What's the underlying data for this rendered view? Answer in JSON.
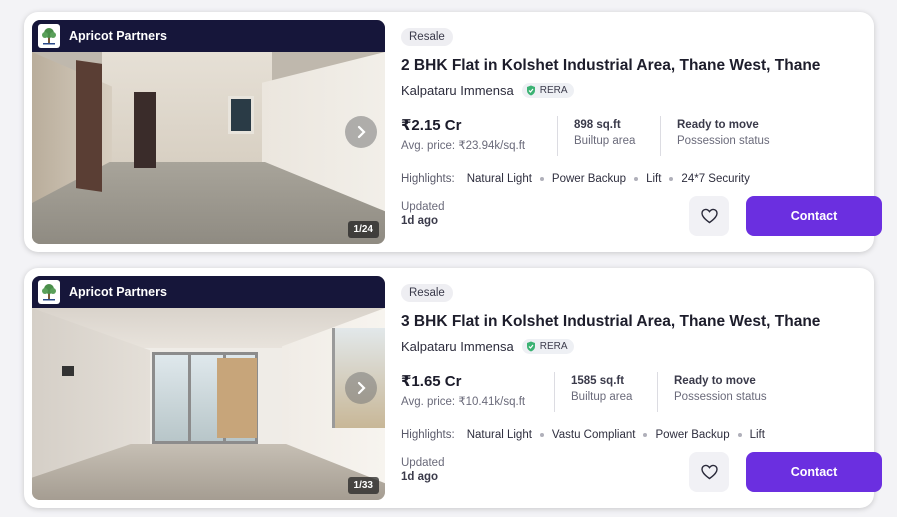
{
  "listings": [
    {
      "agency": "Apricot Partners",
      "photo_counter": "1/24",
      "badge": "Resale",
      "title": "2 BHK Flat in Kolshet Industrial Area, Thane West, Thane",
      "project": "Kalpataru Immensa",
      "rera": "RERA",
      "price": "₹2.15 Cr",
      "avg_price": "Avg. price: ₹23.94k/sq.ft",
      "area_value": "898 sq.ft",
      "area_label": "Builtup area",
      "possession_value": "Ready to move",
      "possession_label": "Possession status",
      "highlights_label": "Highlights:",
      "highlights": [
        "Natural Light",
        "Power Backup",
        "Lift",
        "24*7 Security"
      ],
      "updated_label": "Updated",
      "updated_value": "1d ago",
      "contact_label": "Contact"
    },
    {
      "agency": "Apricot Partners",
      "photo_counter": "1/33",
      "badge": "Resale",
      "title": "3 BHK Flat in Kolshet Industrial Area, Thane West, Thane",
      "project": "Kalpataru Immensa",
      "rera": "RERA",
      "price": "₹1.65 Cr",
      "avg_price": "Avg. price: ₹10.41k/sq.ft",
      "area_value": "1585 sq.ft",
      "area_label": "Builtup area",
      "possession_value": "Ready to move",
      "possession_label": "Possession status",
      "highlights_label": "Highlights:",
      "highlights": [
        "Natural Light",
        "Vastu Compliant",
        "Power Backup",
        "Lift"
      ],
      "updated_label": "Updated",
      "updated_value": "1d ago",
      "contact_label": "Contact"
    }
  ],
  "icons": {
    "agency_logo": "tree-logo-icon",
    "next": "chevron-right-icon",
    "rera": "shield-check-icon",
    "favorite": "heart-icon"
  },
  "colors": {
    "primary": "#6b2fe0",
    "agency_bar": "#16163a",
    "rera_shield": "#3bb273"
  }
}
